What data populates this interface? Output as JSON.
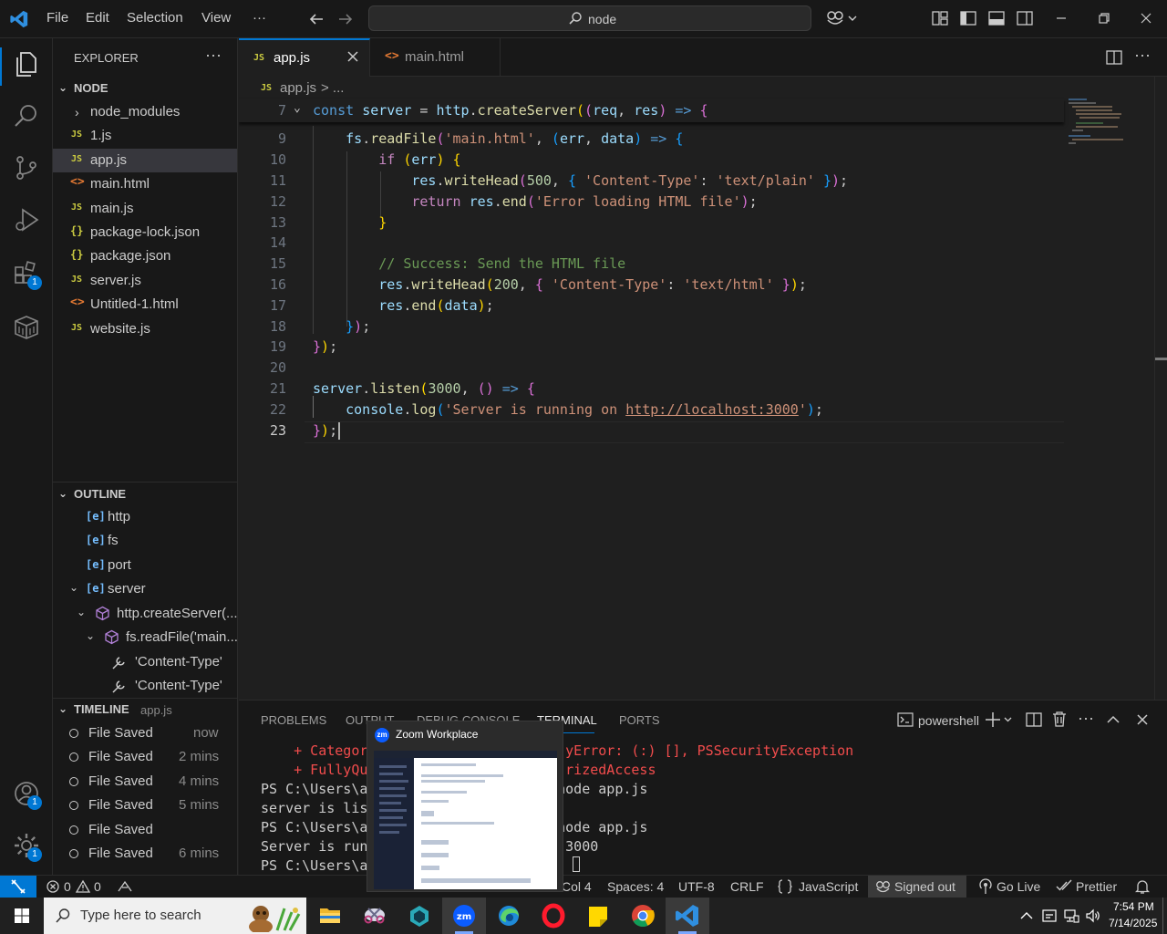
{
  "menu": [
    "File",
    "Edit",
    "Selection",
    "View",
    "···"
  ],
  "search": {
    "text": "node"
  },
  "explorer": {
    "title": "EXPLORER",
    "folder": "NODE",
    "files": [
      {
        "name": "node_modules",
        "type": "folder"
      },
      {
        "name": "1.js",
        "type": "js"
      },
      {
        "name": "app.js",
        "type": "js",
        "selected": true
      },
      {
        "name": "main.html",
        "type": "html"
      },
      {
        "name": "main.js",
        "type": "js"
      },
      {
        "name": "package-lock.json",
        "type": "json"
      },
      {
        "name": "package.json",
        "type": "json"
      },
      {
        "name": "server.js",
        "type": "js"
      },
      {
        "name": "Untitled-1.html",
        "type": "html"
      },
      {
        "name": "website.js",
        "type": "js"
      }
    ]
  },
  "outline": {
    "title": "OUTLINE",
    "items": [
      "http",
      "fs",
      "port",
      "server",
      "http.createServer(...",
      "fs.readFile('main...",
      "'Content-Type'",
      "'Content-Type'"
    ]
  },
  "timeline": {
    "title": "TIMELINE",
    "file": "app.js",
    "entries": [
      {
        "label": "File Saved",
        "time": "now"
      },
      {
        "label": "File Saved",
        "time": "2 mins"
      },
      {
        "label": "File Saved",
        "time": "4 mins"
      },
      {
        "label": "File Saved",
        "time": "5 mins"
      },
      {
        "label": "File Saved",
        "time": ""
      },
      {
        "label": "File Saved",
        "time": "6 mins"
      }
    ]
  },
  "tabs": [
    {
      "label": "app.js",
      "icon": "JS",
      "active": true
    },
    {
      "label": "main.html",
      "icon": "<>",
      "active": false
    }
  ],
  "breadcrumb": {
    "file": "app.js",
    "rest": "> ..."
  },
  "editor": {
    "line_numbers": [
      "7",
      "9",
      "10",
      "11",
      "12",
      "13",
      "14",
      "15",
      "16",
      "17",
      "18",
      "19",
      "20",
      "21",
      "22",
      "23"
    ],
    "lines": [
      "const server = http.createServer((req, res) => {",
      "    fs.readFile('main.html', (err, data) => {",
      "        if (err) {",
      "            res.writeHead(500, { 'Content-Type': 'text/plain' });",
      "            return res.end('Error loading HTML file');",
      "        }",
      "",
      "        // Success: Send the HTML file",
      "        res.writeHead(200, { 'Content-Type': 'text/html' });",
      "        res.end(data);",
      "    });",
      "});",
      "",
      "server.listen(3000, () => {",
      "    console.log('Server is running on http://localhost:3000');",
      "});"
    ]
  },
  "panel": {
    "tabs": [
      "PROBLEMS",
      "OUTPUT",
      "DEBUG CONSOLE",
      "TERMINAL",
      "PORTS"
    ],
    "active_tab": "TERMINAL",
    "shell": "powershell",
    "terminal_lines": [
      "    + Categor                        yError: (:) [], PSSecurityException",
      "    + FullyQu                        rizedAccess",
      "PS C:\\Users\\a                       node app.js",
      "server is lis",
      "PS C:\\Users\\a                       node app.js",
      "Server is run                       :3000",
      "PS C:\\Users\\a"
    ]
  },
  "zoom_popup": {
    "title": "Zoom Workplace"
  },
  "status": {
    "errors": "0",
    "warnings": "0",
    "position": "Col 4",
    "spaces": "Spaces: 4",
    "encoding": "UTF-8",
    "eol": "CRLF",
    "language": "JavaScript",
    "account": "Signed out",
    "golive": "Go Live",
    "prettier": "Prettier"
  },
  "taskbar": {
    "search_placeholder": "Type here to search",
    "time": "7:54 PM",
    "date": "7/14/2025"
  },
  "badges": {
    "extensions": "1",
    "accounts": "1",
    "settings": "1"
  }
}
